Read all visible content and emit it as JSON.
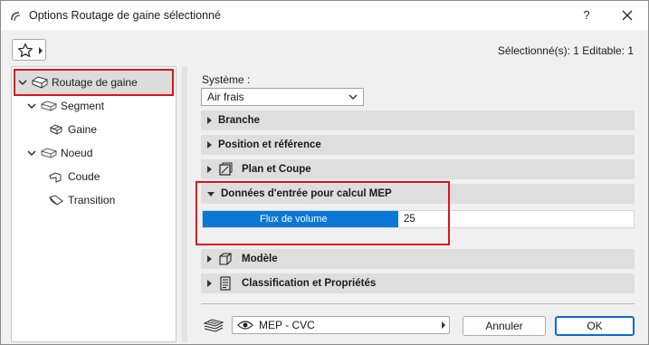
{
  "window": {
    "title": "Options Routage de gaine sélectionné",
    "help_label": "?"
  },
  "toolbar": {
    "favorites_icon": "star-icon",
    "selection_info": "Sélectionné(s): 1 Editable: 1"
  },
  "tree": {
    "items": [
      {
        "label": "Routage de gaine",
        "icon": "duct-route-icon",
        "level": 0,
        "expanded": true,
        "selected": true
      },
      {
        "label": "Segment",
        "icon": "duct-segment-icon",
        "level": 1,
        "expanded": true
      },
      {
        "label": "Gaine",
        "icon": "duct-icon",
        "level": 2
      },
      {
        "label": "Noeud",
        "icon": "duct-node-icon",
        "level": 1,
        "expanded": true
      },
      {
        "label": "Coude",
        "icon": "elbow-icon",
        "level": 2
      },
      {
        "label": "Transition",
        "icon": "transition-icon",
        "level": 2
      }
    ]
  },
  "system": {
    "label": "Système :",
    "value": "Air frais"
  },
  "sections": [
    {
      "label": "Branche",
      "expanded": false
    },
    {
      "label": "Position et référence",
      "expanded": false
    },
    {
      "label": "Plan et Coupe",
      "expanded": false,
      "icon": "plan-section-icon"
    },
    {
      "label": "Données d'entrée pour calcul MEP",
      "expanded": true
    },
    {
      "label": "Modèle",
      "expanded": false,
      "icon": "model-cube-icon"
    },
    {
      "label": "Classification et Propriétés",
      "expanded": false,
      "icon": "properties-doc-icon"
    }
  ],
  "mep_input": {
    "field_label": "Flux de volume",
    "field_value": "25"
  },
  "footer": {
    "layers_icon": "layers-icon",
    "translator_label": "MEP - CVC",
    "cancel_label": "Annuler",
    "ok_label": "OK"
  },
  "colors": {
    "highlight_red": "#e0101a",
    "selection_blue": "#0a78d4"
  }
}
